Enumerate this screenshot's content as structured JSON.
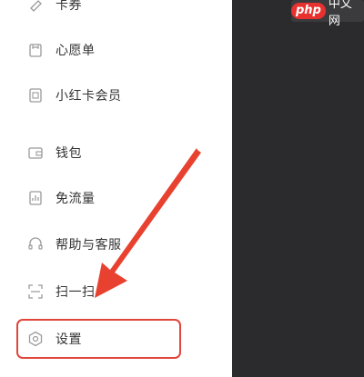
{
  "menu": {
    "items": [
      {
        "label": "卡券",
        "icon": "ticket-icon"
      },
      {
        "label": "心愿单",
        "icon": "wishlist-icon"
      },
      {
        "label": "小红卡会员",
        "icon": "member-card-icon"
      },
      {
        "label": "钱包",
        "icon": "wallet-icon"
      },
      {
        "label": "免流量",
        "icon": "free-data-icon"
      },
      {
        "label": "帮助与客服",
        "icon": "headset-icon"
      },
      {
        "label": "扫一扫",
        "icon": "scan-icon"
      },
      {
        "label": "设置",
        "icon": "settings-icon"
      }
    ]
  },
  "watermark": {
    "logo": "php",
    "text": "中文网"
  },
  "colors": {
    "highlight": "#e0463a",
    "arrow": "#e8412f",
    "dark_panel": "#2b2b2d",
    "text": "#333333",
    "icon": "#9a9a9a"
  }
}
